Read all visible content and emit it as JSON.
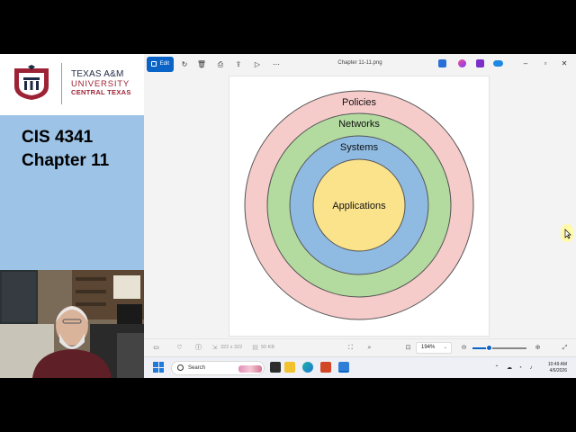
{
  "slide": {
    "logo": {
      "line1": "TEXAS A&M",
      "line2": "UNIVERSITY",
      "line3": "CENTRAL TEXAS",
      "icon": "university-seal-icon"
    },
    "title_line1": "CIS 4341",
    "title_line2": "Chapter 11"
  },
  "photos_app": {
    "file_name": "Chapter 11-11.png",
    "edit_label": "Edit",
    "toolbar_icons": [
      "edit-icon",
      "rotate-icon",
      "delete-icon",
      "print-icon",
      "share-icon",
      "slideshow-icon",
      "more-icon"
    ],
    "right_icons": [
      "designer-icon",
      "copilot-icon",
      "clipchamp-icon",
      "onedrive-icon"
    ],
    "window_controls": [
      "minimize-icon",
      "maximize-icon",
      "close-icon"
    ],
    "image_info": {
      "dimensions": "322 x 322",
      "size": "50 KB"
    },
    "zoom": "194%",
    "zoom_slider_fraction": 0.3
  },
  "diagram": {
    "rings": [
      {
        "label": "Policies",
        "color": "#f6cccb"
      },
      {
        "label": "Networks",
        "color": "#b3dba0"
      },
      {
        "label": "Systems",
        "color": "#8fbbe3"
      },
      {
        "label": "Applications",
        "color": "#fbe38c"
      }
    ]
  },
  "taskbar": {
    "search_label": "Search",
    "time": "10:49 AM",
    "date": "4/6/2026"
  }
}
